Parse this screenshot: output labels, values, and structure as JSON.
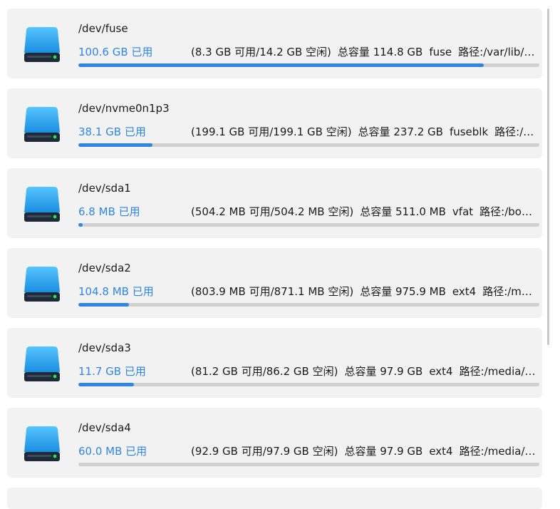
{
  "disks": [
    {
      "name": "/dev/fuse",
      "used": "100.6 GB 已用",
      "avail": "(8.3 GB 可用/14.2 GB 空闲)",
      "total": "总容量 114.8 GB",
      "fs": "fuse",
      "path": "路径:/var/lib/k…",
      "usage_fraction": 0.88
    },
    {
      "name": "/dev/nvme0n1p3",
      "used": "38.1 GB 已用",
      "avail": "(199.1 GB 可用/199.1 GB 空闲)",
      "total": "总容量 237.2 GB",
      "fs": "fuseblk",
      "path": "路径:/m…",
      "usage_fraction": 0.16
    },
    {
      "name": "/dev/sda1",
      "used": "6.8 MB 已用",
      "avail": "(504.2 MB 可用/504.2 MB 空闲)",
      "total": "总容量 511.0 MB",
      "fs": "vfat",
      "path": "路径:/boot…",
      "usage_fraction": 0.01
    },
    {
      "name": "/dev/sda2",
      "used": "104.8 MB 已用",
      "avail": "(803.9 MB 可用/871.1 MB 空闲)",
      "total": "总容量 975.9 MB",
      "fs": "ext4",
      "path": "路径:/med…",
      "usage_fraction": 0.11
    },
    {
      "name": "/dev/sda3",
      "used": "11.7 GB 已用",
      "avail": "(81.2 GB 可用/86.2 GB 空闲)",
      "total": "总容量 97.9 GB",
      "fs": "ext4",
      "path": "路径:/media/k…",
      "usage_fraction": 0.12
    },
    {
      "name": "/dev/sda4",
      "used": "60.0 MB 已用",
      "avail": "(92.9 GB 可用/97.9 GB 空闲)",
      "total": "总容量 97.9 GB",
      "fs": "ext4",
      "path": "路径:/media/k…",
      "usage_fraction": 0.0
    }
  ],
  "colors": {
    "accent": "#2f86e6",
    "card_bg": "#f2f2f2",
    "bar_track": "#d0d0d0"
  },
  "icon": "hard-drive-icon"
}
